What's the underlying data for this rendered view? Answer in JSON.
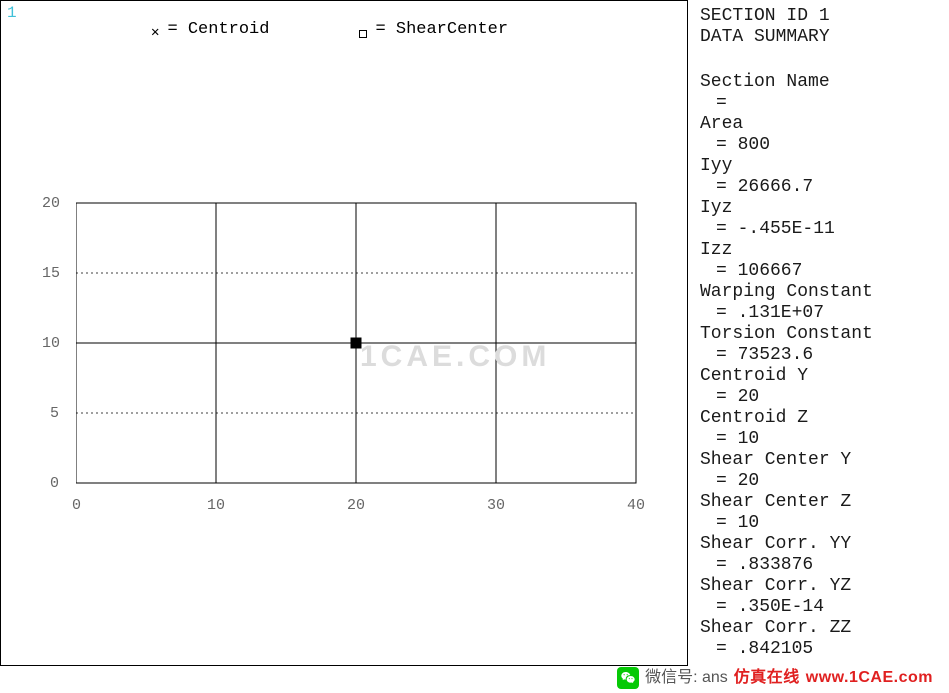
{
  "viewport_number": "1",
  "legend": {
    "centroid_label": "= Centroid",
    "shear_label": "= ShearCenter"
  },
  "watermark": "1CAE.COM",
  "axes": {
    "x_ticks": [
      "0",
      "10",
      "20",
      "30",
      "40"
    ],
    "y_ticks": [
      "0",
      "5",
      "10",
      "15",
      "20"
    ]
  },
  "section": {
    "title_line1": "SECTION ID 1",
    "title_line2": "DATA SUMMARY",
    "name_label": "Section Name",
    "name_value": "=",
    "props": [
      {
        "label": "Area",
        "value": "= 800"
      },
      {
        "label": "Iyy",
        "value": "= 26666.7"
      },
      {
        "label": "Iyz",
        "value": "= -.455E-11"
      },
      {
        "label": "Izz",
        "value": "= 106667"
      },
      {
        "label": "Warping Constant",
        "value": "= .131E+07"
      },
      {
        "label": "Torsion Constant",
        "value": "= 73523.6"
      },
      {
        "label": "Centroid Y",
        "value": "= 20"
      },
      {
        "label": "Centroid Z",
        "value": "= 10"
      },
      {
        "label": "Shear Center Y",
        "value": "= 20"
      },
      {
        "label": "Shear Center Z",
        "value": "= 10"
      },
      {
        "label": "Shear Corr. YY",
        "value": "= .833876"
      },
      {
        "label": "Shear Corr. YZ",
        "value": "= .350E-14"
      },
      {
        "label": "Shear Corr. ZZ",
        "value": "= .842105"
      }
    ]
  },
  "footer": {
    "wechat_label": "微信号: ans",
    "brand_cn": "仿真在线",
    "brand_url": "www.1CAE.com"
  },
  "chart_data": {
    "type": "diagram",
    "title": "Beam section mesh plot with centroid and shear-center markers",
    "xlabel": "",
    "ylabel": "",
    "xlim": [
      0,
      40
    ],
    "ylim": [
      0,
      20
    ],
    "section_outline": {
      "x": [
        0,
        40,
        40,
        0,
        0
      ],
      "y": [
        0,
        0,
        20,
        20,
        0
      ]
    },
    "mesh_vlines_x": [
      0,
      10,
      20,
      30,
      40
    ],
    "mesh_hlines_y_solid": [
      0,
      10,
      20
    ],
    "mesh_hlines_y_dotted": [
      5,
      15
    ],
    "markers": [
      {
        "name": "Centroid",
        "symbol": "x",
        "x": 20,
        "y": 10
      },
      {
        "name": "ShearCenter",
        "symbol": "square",
        "x": 20,
        "y": 10
      }
    ]
  }
}
